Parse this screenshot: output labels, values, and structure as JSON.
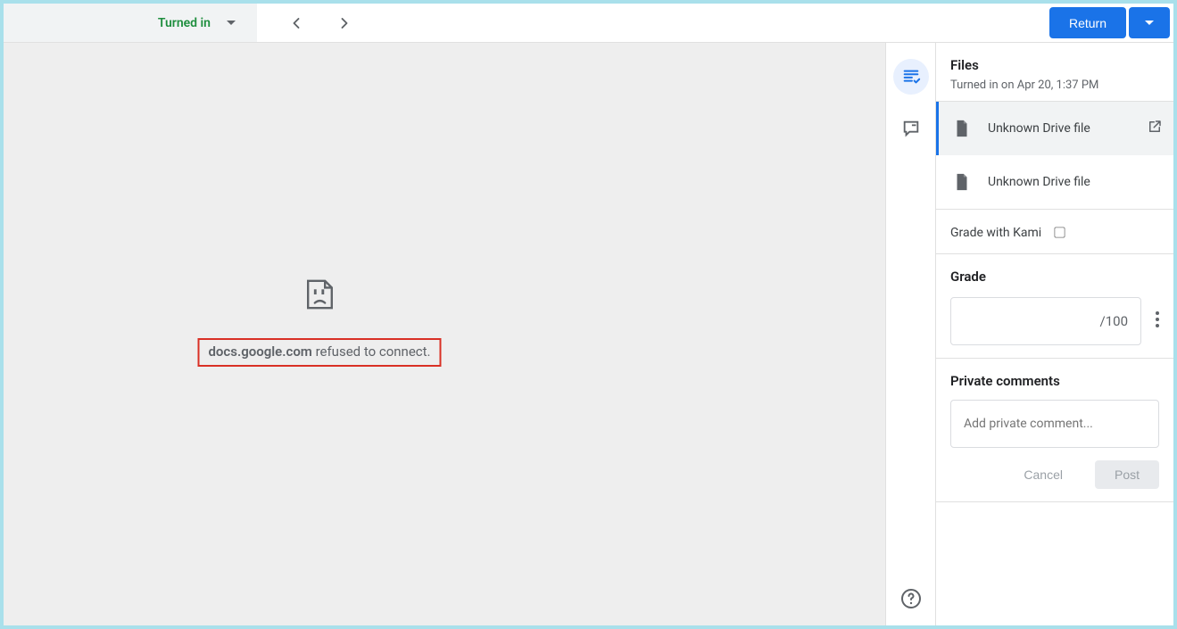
{
  "topbar": {
    "status_label": "Turned in",
    "return_label": "Return"
  },
  "error": {
    "domain": "docs.google.com",
    "message_suffix": " refused to connect."
  },
  "side": {
    "files_heading": "Files",
    "turned_in_line": "Turned in on Apr 20, 1:37 PM",
    "file_items": [
      {
        "name": "Unknown Drive file"
      },
      {
        "name": "Unknown Drive file"
      }
    ],
    "kami_label": "Grade with Kami",
    "grade_heading": "Grade",
    "grade_denominator": "/100",
    "comments_heading": "Private comments",
    "comment_placeholder": "Add private comment...",
    "cancel_label": "Cancel",
    "post_label": "Post"
  }
}
